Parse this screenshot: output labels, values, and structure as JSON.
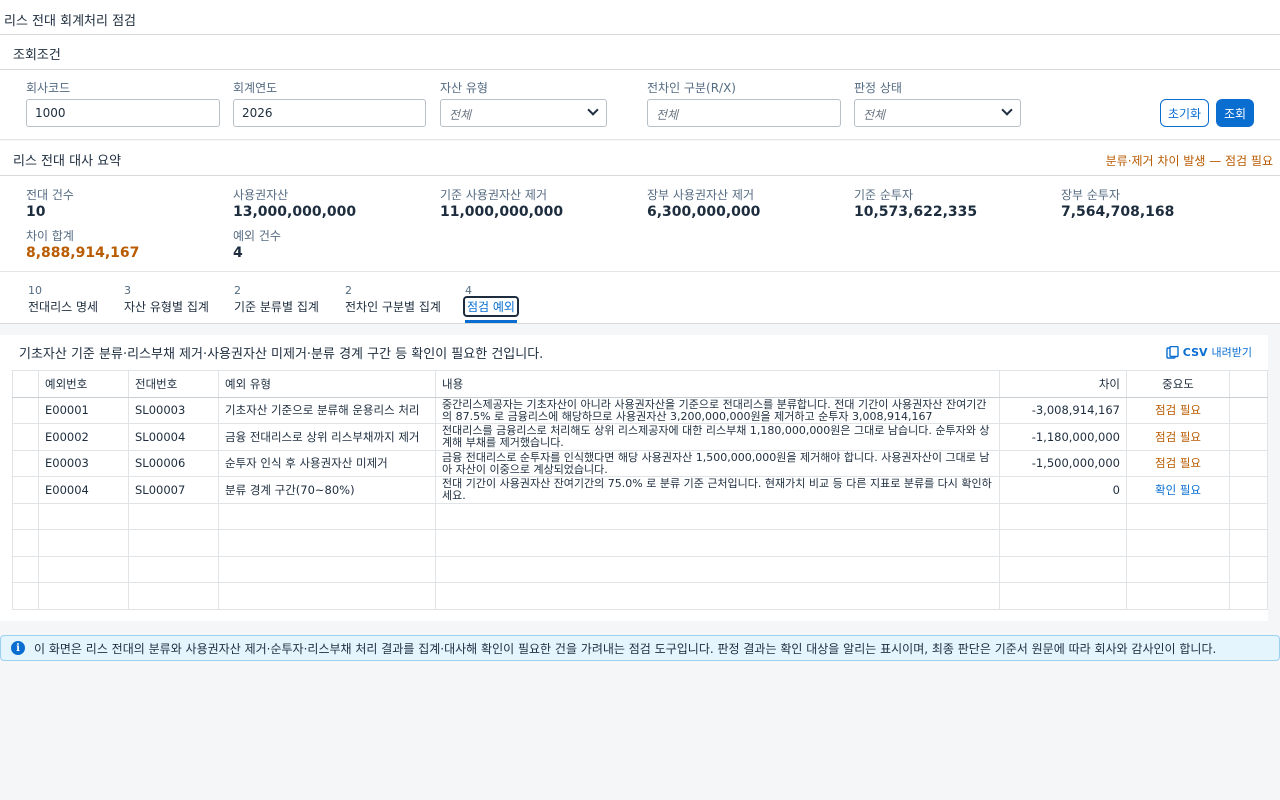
{
  "app": {
    "title": "리스 전대 회계처리 점검"
  },
  "filters": {
    "section_title": "조회조건",
    "company_code": {
      "label": "회사코드",
      "value": "1000"
    },
    "fiscal_year": {
      "label": "회계연도",
      "value": "2026"
    },
    "asset_type": {
      "label": "자산 유형",
      "placeholder": "전체"
    },
    "lessor_type": {
      "label": "전차인 구분(R/X)",
      "placeholder": "전체"
    },
    "judgment_status": {
      "label": "판정 상태",
      "placeholder": "전체"
    },
    "reset_label": "초기화",
    "search_label": "조회"
  },
  "summary": {
    "title": "리스 전대 대사 요약",
    "warning": "분류·제거 차이 발생 — 점검 필요",
    "kpis": [
      {
        "label": "전대 건수",
        "value": "10"
      },
      {
        "label": "사용권자산",
        "value": "13,000,000,000"
      },
      {
        "label": "기준 사용권자산 제거",
        "value": "11,000,000,000"
      },
      {
        "label": "장부 사용권자산 제거",
        "value": "6,300,000,000"
      },
      {
        "label": "기준 순투자",
        "value": "10,573,622,335"
      },
      {
        "label": "장부 순투자",
        "value": "7,564,708,168"
      },
      {
        "label": "차이 합계",
        "value": "8,888,914,167"
      },
      {
        "label": "예외 건수",
        "value": "4"
      }
    ]
  },
  "tabs": [
    {
      "count": "10",
      "label": "전대리스 명세"
    },
    {
      "count": "3",
      "label": "자산 유형별 집계"
    },
    {
      "count": "2",
      "label": "기준 분류별 집계"
    },
    {
      "count": "2",
      "label": "전차인 구분별 집계"
    },
    {
      "count": "4",
      "label": "점검 예외"
    }
  ],
  "exceptions": {
    "description": "기초자산 기준 분류·리스부채 제거·사용권자산 미제거·분류 경계 구간 등 확인이 필요한 건입니다.",
    "csv_label": "CSV",
    "csv_suffix": "내려받기",
    "columns": [
      "예외번호",
      "전대번호",
      "예외 유형",
      "내용",
      "차이",
      "중요도"
    ],
    "rows": [
      {
        "id": "E00001",
        "sublease": "SL00003",
        "type": "기초자산 기준으로 분류해 운용리스 처리",
        "content": "중간리스제공자는 기초자산이 아니라 사용권자산을 기준으로 전대리스를 분류합니다. 전대 기간이 사용권자산 잔여기간의 87.5% 로 금융리스에 해당하므로 사용권자산 3,200,000,000원을 제거하고 순투자 3,008,914,167",
        "diff": "-3,008,914,167",
        "severity": "점검 필요"
      },
      {
        "id": "E00002",
        "sublease": "SL00004",
        "type": "금융 전대리스로 상위 리스부채까지 제거",
        "content": "전대리스를 금융리스로 처리해도 상위 리스제공자에 대한 리스부채 1,180,000,000원은 그대로 남습니다. 순투자와 상계해 부채를 제거했습니다.",
        "diff": "-1,180,000,000",
        "severity": "점검 필요"
      },
      {
        "id": "E00003",
        "sublease": "SL00006",
        "type": "순투자 인식 후 사용권자산 미제거",
        "content": "금융 전대리스로 순투자를 인식했다면 해당 사용권자산 1,500,000,000원을 제거해야 합니다. 사용권자산이 그대로 남아 자산이 이중으로 계상되었습니다.",
        "diff": "-1,500,000,000",
        "severity": "점검 필요"
      },
      {
        "id": "E00004",
        "sublease": "SL00007",
        "type": "분류 경계 구간(70~80%)",
        "content": "전대 기간이 사용권자산 잔여기간의 75.0% 로 분류 기준 근처입니다. 현재가치 비교 등 다른 지표로 분류를 다시 확인하세요.",
        "diff": "0",
        "severity": "확인 필요"
      }
    ]
  },
  "info": {
    "message": "이 화면은 리스 전대의 분류와 사용권자산 제거·순투자·리스부채 처리 결과를 집계·대사해 확인이 필요한 건을 가려내는 점검 도구입니다. 판정 결과는 확인 대상을 알리는 표시이며, 최종 판단은 기준서 원문에 따라 회사와 감사인이 합니다."
  },
  "colors": {
    "accent": "#0a6ed1",
    "warning": "#b95b00",
    "info_bg": "#e5f5fe"
  }
}
